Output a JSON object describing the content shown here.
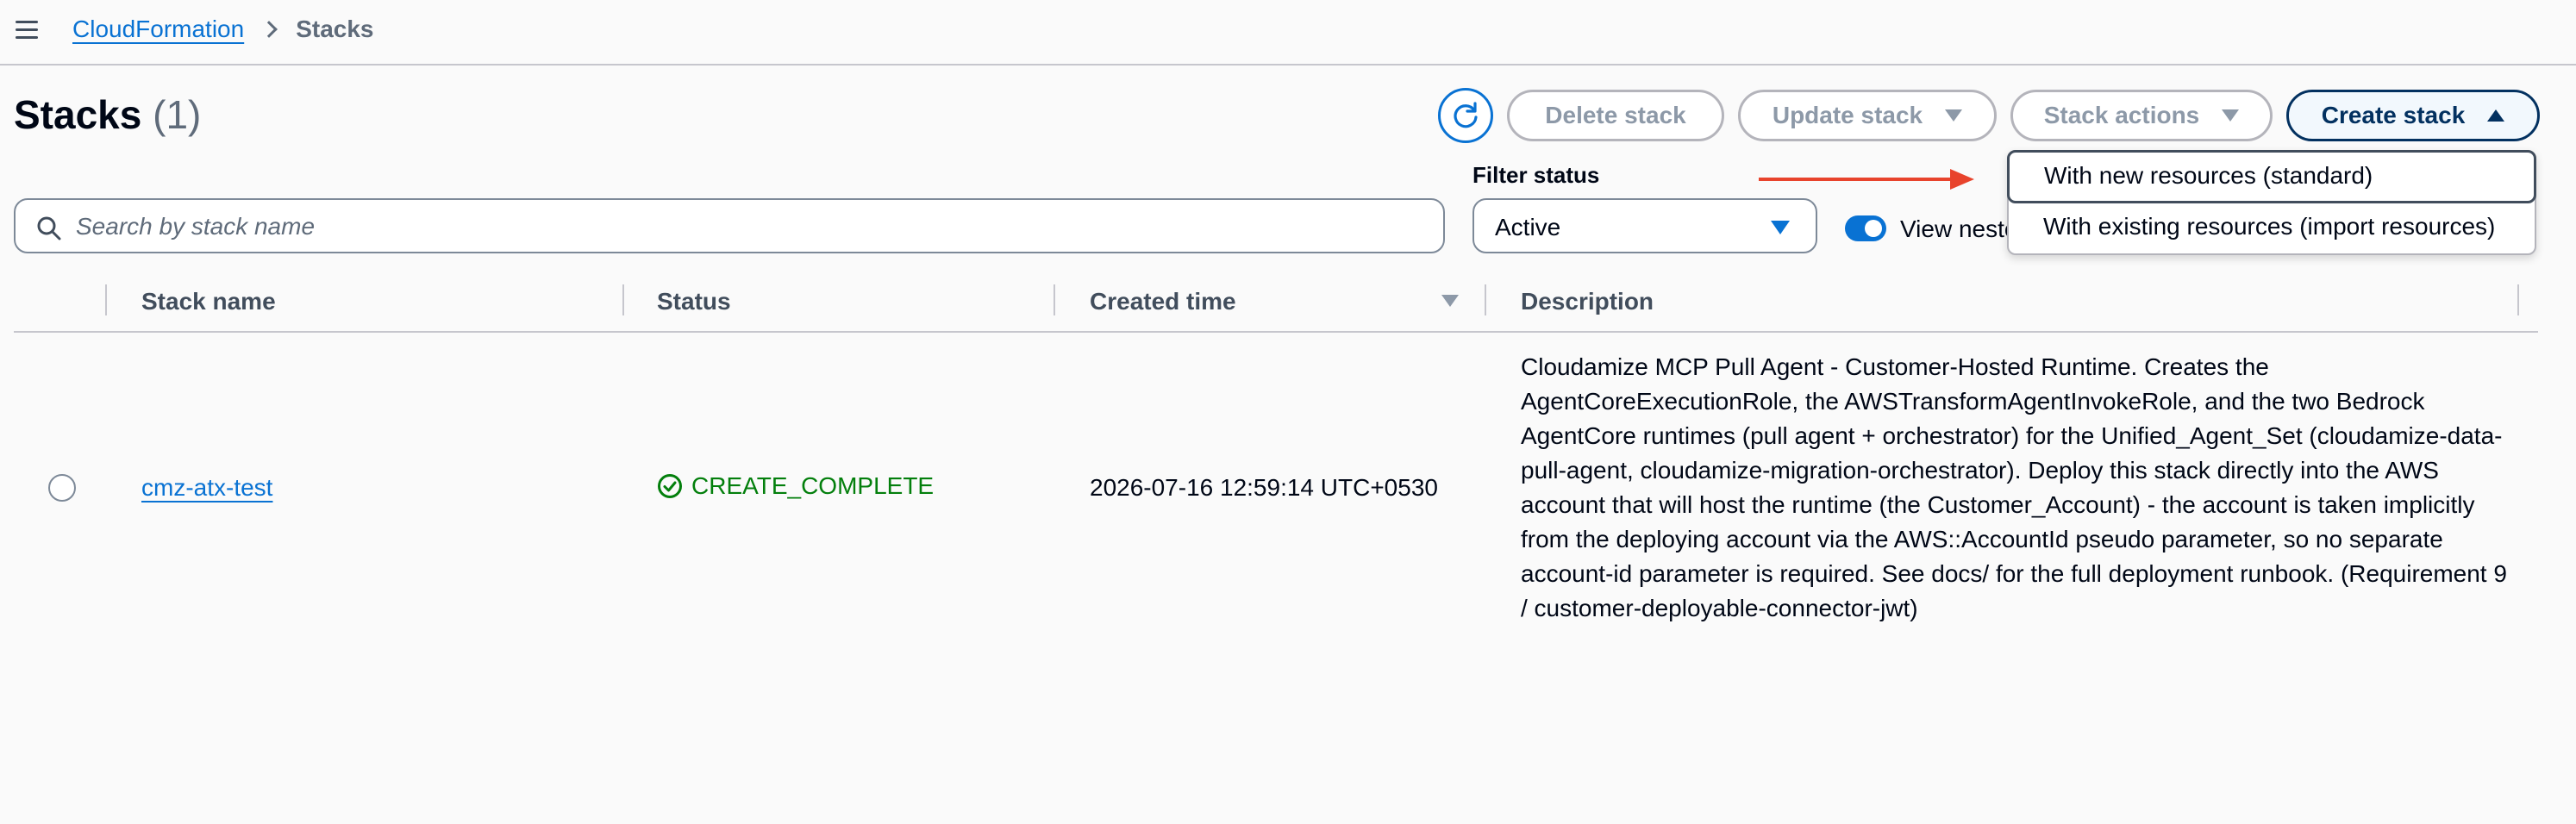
{
  "breadcrumb": {
    "service": "CloudFormation",
    "current": "Stacks"
  },
  "header": {
    "title": "Stacks",
    "count": "(1)"
  },
  "toolbar": {
    "delete_label": "Delete stack",
    "update_label": "Update stack",
    "actions_label": "Stack actions",
    "create_label": "Create stack"
  },
  "create_menu": {
    "items": [
      "With new resources (standard)",
      "With existing resources (import resources)"
    ]
  },
  "filter": {
    "search_placeholder": "Search by stack name",
    "status_label": "Filter status",
    "status_value": "Active",
    "toggle_label": "View nested",
    "toggle_on": true
  },
  "table": {
    "columns": [
      "Stack name",
      "Status",
      "Created time",
      "Description"
    ],
    "rows": [
      {
        "name": "cmz-atx-test",
        "status": "CREATE_COMPLETE",
        "created": "2026-07-16 12:59:14 UTC+0530",
        "description": "Cloudamize MCP Pull Agent - Customer-Hosted Runtime. Creates the AgentCoreExecutionRole, the AWSTransformAgentInvokeRole, and the two Bedrock AgentCore runtimes (pull agent + orchestrator) for the Unified_Agent_Set (cloudamize-data-pull-agent, cloudamize-migration-orchestrator). Deploy this stack directly into the AWS account that will host the runtime (the Customer_Account) - the account is taken implicitly from the deploying account via the AWS::AccountId pseudo parameter, so no separate account-id parameter is required. See docs/ for the full deployment runbook. (Requirement 9 / customer-deployable-connector-jwt)"
      }
    ]
  },
  "colors": {
    "accent": "#0972d3",
    "success": "#037f0c",
    "annotation_arrow": "#e8432c"
  },
  "icons": [
    "menu-icon",
    "chevron-right-icon",
    "refresh-icon",
    "search-icon",
    "caret-down-icon",
    "caret-up-icon",
    "check-circle-icon"
  ]
}
